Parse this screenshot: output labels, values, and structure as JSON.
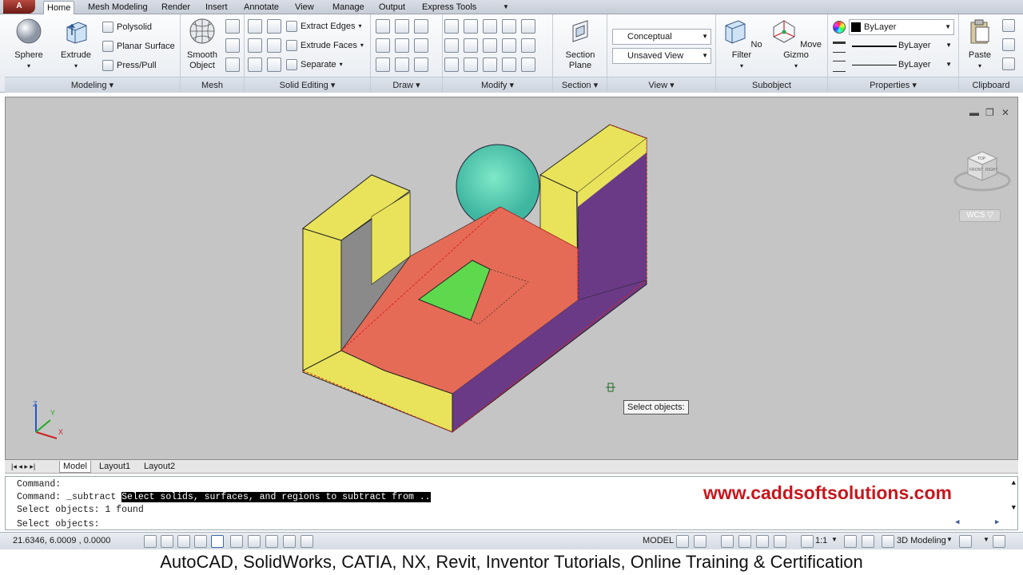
{
  "tabs": [
    "Home",
    "Mesh Modeling",
    "Render",
    "Insert",
    "Annotate",
    "View",
    "Manage",
    "Output",
    "Express Tools"
  ],
  "panels": {
    "modeling": {
      "title": "Modeling",
      "sphere": "Sphere",
      "extrude": "Extrude",
      "polysolid": "Polysolid",
      "planar_surface": "Planar Surface",
      "press_pull": "Press/Pull"
    },
    "mesh": {
      "title": "Mesh",
      "smooth_object": "Smooth Object"
    },
    "solid_editing": {
      "title": "Solid Editing",
      "extract_edges": "Extract Edges",
      "extrude_faces": "Extrude Faces",
      "separate": "Separate"
    },
    "draw": {
      "title": "Draw"
    },
    "modify": {
      "title": "Modify"
    },
    "section": {
      "title": "Section",
      "section_plane": "Section Plane"
    },
    "view": {
      "title": "View",
      "visual_style": "Conceptual",
      "saved_view": "Unsaved View"
    },
    "subobject": {
      "title": "Subobject",
      "no_filter": "No Filter",
      "move_gizmo": "Move Gizmo"
    },
    "properties": {
      "title": "Properties",
      "color": "ByLayer",
      "linetype": "ByLayer",
      "lineweight": "ByLayer"
    },
    "clipboard": {
      "title": "Clipboard",
      "paste": "Paste"
    }
  },
  "viewport": {
    "tooltip": "Select objects:",
    "wcs_label": "WCS",
    "viewcube_labels": {
      "top": "TOP",
      "front": "FRONT",
      "right": "RIGHT"
    }
  },
  "layout_tabs": [
    "Model",
    "Layout1",
    "Layout2"
  ],
  "command": {
    "line1": "Command:",
    "line2_prefix": "Command: _subtract ",
    "line2_highlight": "Select solids, surfaces, and regions to subtract from ..",
    "line3": "Select objects: 1 found",
    "line4": "Select objects:"
  },
  "watermark": "www.caddsoftsolutions.com",
  "status": {
    "coords": "21.6346, 6.0009 , 0.0000",
    "model": "MODEL",
    "scale": "1:1",
    "workspace": "3D Modeling"
  },
  "footer": "AutoCAD, SolidWorks, CATIA, NX, Revit, Inventor Tutorials, Online Training & Certification",
  "colors": {
    "yellow_face": "#e8e35a",
    "purple_face": "#6a3a86",
    "red_face": "#e56b56",
    "green_face": "#5ed84d",
    "sphere": "#5fd3b4",
    "viewport_bg": "#c5c5c5"
  }
}
